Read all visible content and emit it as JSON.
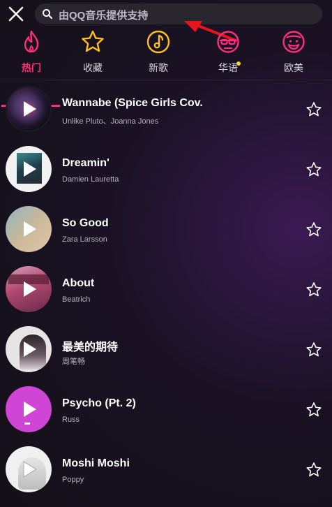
{
  "search": {
    "placeholder": "由QQ音乐提供支持"
  },
  "tabs": [
    {
      "label": "热门",
      "icon": "flame-icon",
      "active": true
    },
    {
      "label": "收藏",
      "icon": "star-icon",
      "active": false
    },
    {
      "label": "新歌",
      "icon": "music-note-icon",
      "active": false
    },
    {
      "label": "华语",
      "icon": "face-glasses-icon",
      "active": false,
      "has_dot": true
    },
    {
      "label": "欧美",
      "icon": "face-beard-icon",
      "active": false
    }
  ],
  "songs": [
    {
      "title": "Wannabe (Spice Girls Cov.",
      "artist": "Unlike Pluto、Joanna Jones"
    },
    {
      "title": "Dreamin'",
      "artist": "Damien Lauretta"
    },
    {
      "title": "So Good",
      "artist": "Zara Larsson"
    },
    {
      "title": "About",
      "artist": "Beatrich"
    },
    {
      "title": "最美的期待",
      "artist": "周笔畅"
    },
    {
      "title": "Psycho (Pt. 2)",
      "artist": "Russ"
    },
    {
      "title": "Moshi Moshi",
      "artist": "Poppy"
    }
  ],
  "colors": {
    "accent": "#ff2e7a",
    "tab_icon": "#ffc21a",
    "dot": "#ffcf2e"
  }
}
